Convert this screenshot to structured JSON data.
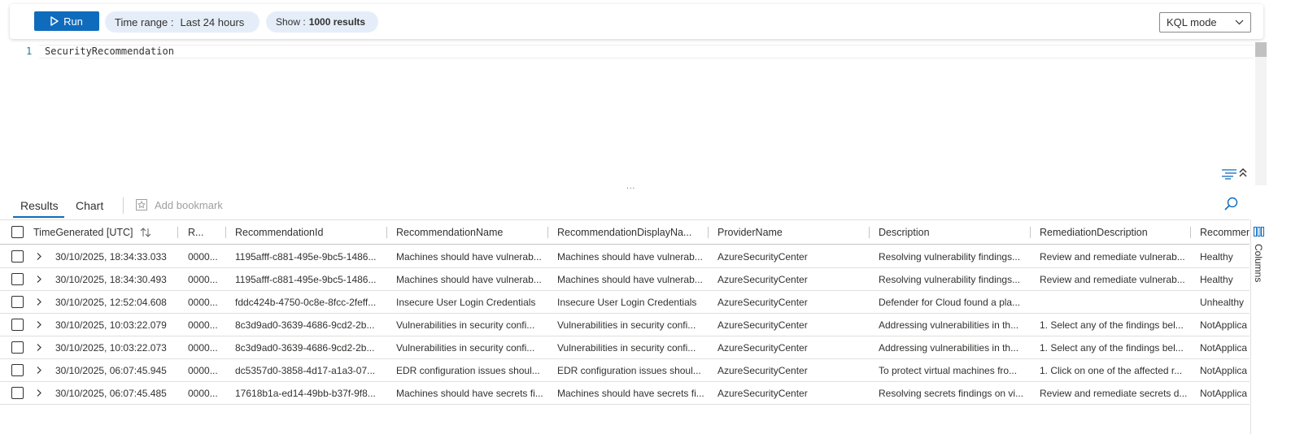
{
  "toolbar": {
    "run_label": "Run",
    "time_range_label": "Time range :",
    "time_range_value": "Last 24 hours",
    "show_label": "Show :",
    "show_value": "1000 results",
    "mode_label": "KQL mode"
  },
  "editor": {
    "line_number": "1",
    "query": "SecurityRecommendation"
  },
  "splitter": "...",
  "results_tabs": {
    "results": "Results",
    "chart": "Chart",
    "add_bookmark": "Add bookmark"
  },
  "columns_panel": {
    "label": "Columns"
  },
  "table": {
    "headers": {
      "time": "TimeGenerated [UTC]",
      "r": "R...",
      "recommendation_id": "RecommendationId",
      "recommendation_name": "RecommendationName",
      "recommendation_display_name": "RecommendationDisplayNa...",
      "provider_name": "ProviderName",
      "description": "Description",
      "remediation_description": "RemediationDescription",
      "recommendation_state": "Recommen"
    },
    "rows": [
      {
        "time": "30/10/2025, 18:34:33.033",
        "r": "0000...",
        "rid": "1195afff-c881-495e-9bc5-1486...",
        "rname": "Machines should have vulnerab...",
        "rdisp": "Machines should have vulnerab...",
        "prov": "AzureSecurityCenter",
        "desc": "Resolving vulnerability findings...",
        "rem": "Review and remediate vulnerab...",
        "rec": "Healthy"
      },
      {
        "time": "30/10/2025, 18:34:30.493",
        "r": "0000...",
        "rid": "1195afff-c881-495e-9bc5-1486...",
        "rname": "Machines should have vulnerab...",
        "rdisp": "Machines should have vulnerab...",
        "prov": "AzureSecurityCenter",
        "desc": "Resolving vulnerability findings...",
        "rem": "Review and remediate vulnerab...",
        "rec": "Healthy"
      },
      {
        "time": "30/10/2025, 12:52:04.608",
        "r": "0000...",
        "rid": "fddc424b-4750-0c8e-8fcc-2feff...",
        "rname": "Insecure User Login Credentials",
        "rdisp": "Insecure User Login Credentials",
        "prov": "AzureSecurityCenter",
        "desc": "Defender for Cloud found a pla...",
        "rem": "",
        "rec": "Unhealthy"
      },
      {
        "time": "30/10/2025, 10:03:22.079",
        "r": "0000...",
        "rid": "8c3d9ad0-3639-4686-9cd2-2b...",
        "rname": "Vulnerabilities in security confi...",
        "rdisp": "Vulnerabilities in security confi...",
        "prov": "AzureSecurityCenter",
        "desc": "Addressing vulnerabilities in th...",
        "rem": "1. Select any of the findings bel...",
        "rec": "NotApplica"
      },
      {
        "time": "30/10/2025, 10:03:22.073",
        "r": "0000...",
        "rid": "8c3d9ad0-3639-4686-9cd2-2b...",
        "rname": "Vulnerabilities in security confi...",
        "rdisp": "Vulnerabilities in security confi...",
        "prov": "AzureSecurityCenter",
        "desc": "Addressing vulnerabilities in th...",
        "rem": "1. Select any of the findings bel...",
        "rec": "NotApplica"
      },
      {
        "time": "30/10/2025, 06:07:45.945",
        "r": "0000...",
        "rid": "dc5357d0-3858-4d17-a1a3-07...",
        "rname": "EDR configuration issues shoul...",
        "rdisp": "EDR configuration issues shoul...",
        "prov": "AzureSecurityCenter",
        "desc": "To protect virtual machines fro...",
        "rem": "1. Click on one of the affected r...",
        "rec": "NotApplica"
      },
      {
        "time": "30/10/2025, 06:07:45.485",
        "r": "0000...",
        "rid": "17618b1a-ed14-49bb-b37f-9f8...",
        "rname": "Machines should have secrets fi...",
        "rdisp": "Machines should have secrets fi...",
        "prov": "AzureSecurityCenter",
        "desc": "Resolving secrets findings on vi...",
        "rem": "Review and remediate secrets d...",
        "rec": "NotApplica"
      }
    ]
  }
}
